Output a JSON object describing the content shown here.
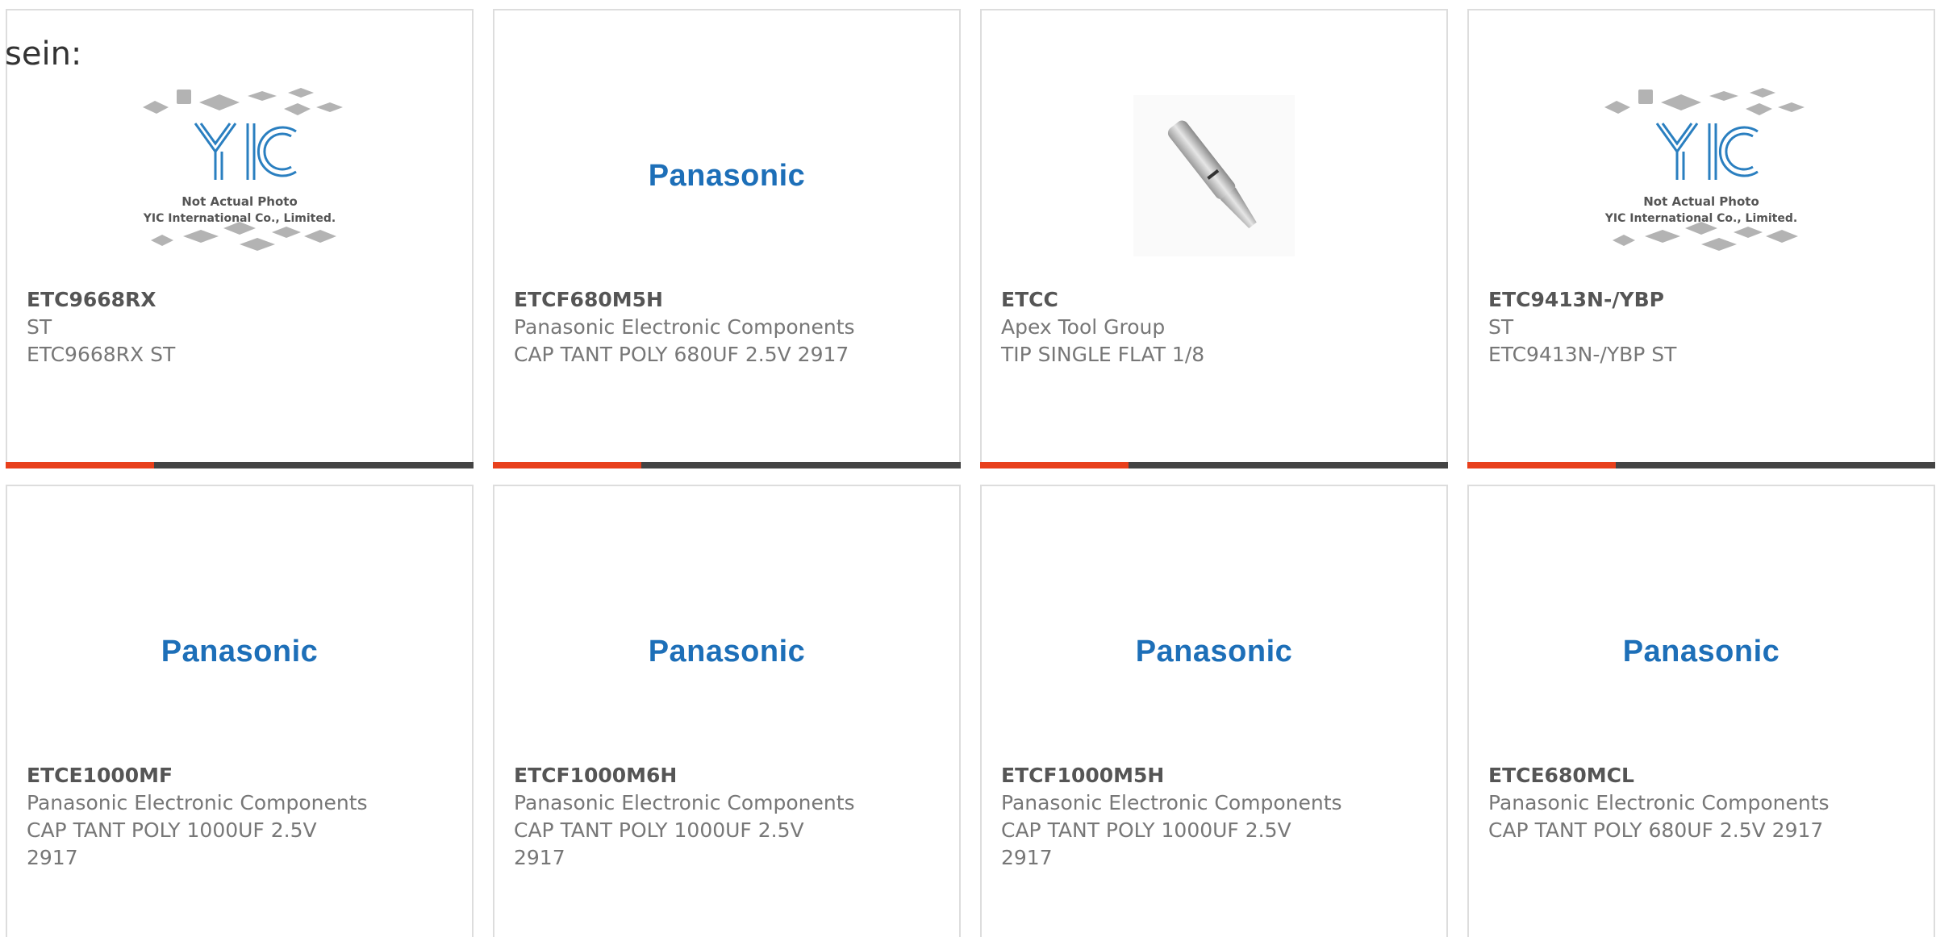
{
  "page": {
    "lead_text": "sein:"
  },
  "colors": {
    "accent": "#e8401c",
    "bar": "#444444",
    "panasonic_blue": "#1d6fb8",
    "yic_blue": "#2a7fc0"
  },
  "cards": [
    {
      "part": "ETC9668RX",
      "mfr": "ST",
      "desc": "ETC9668RX ST",
      "image": "yic-not-actual-photo",
      "image_text": {
        "line1": "Not Actual Photo",
        "line2": "YIC International Co., Limited.",
        "logo": "YIC"
      }
    },
    {
      "part": "ETCF680M5H",
      "mfr": "Panasonic Electronic Components",
      "desc": "CAP TANT POLY 680UF 2.5V 2917",
      "image": "panasonic-logo",
      "logo_text": "Panasonic"
    },
    {
      "part": "ETCC",
      "mfr": "Apex Tool Group",
      "desc": "TIP SINGLE FLAT 1/8",
      "image": "solder-tip-photo"
    },
    {
      "part": "ETC9413N-/YBP",
      "mfr": "ST",
      "desc": "ETC9413N-/YBP ST",
      "image": "yic-not-actual-photo",
      "image_text": {
        "line1": "Not Actual Photo",
        "line2": "YIC International Co., Limited.",
        "logo": "YIC"
      }
    },
    {
      "part": "ETCE1000MF",
      "mfr": "Panasonic Electronic Components",
      "desc1": "CAP TANT POLY 1000UF 2.5V",
      "desc2": "2917",
      "image": "panasonic-logo",
      "logo_text": "Panasonic"
    },
    {
      "part": "ETCF1000M6H",
      "mfr": "Panasonic Electronic Components",
      "desc1": "CAP TANT POLY 1000UF 2.5V",
      "desc2": "2917",
      "image": "panasonic-logo",
      "logo_text": "Panasonic"
    },
    {
      "part": "ETCF1000M5H",
      "mfr": "Panasonic Electronic Components",
      "desc1": "CAP TANT POLY 1000UF 2.5V",
      "desc2": "2917",
      "image": "panasonic-logo",
      "logo_text": "Panasonic"
    },
    {
      "part": "ETCE680MCL",
      "mfr": "Panasonic Electronic Components",
      "desc": "CAP TANT POLY 680UF 2.5V 2917",
      "image": "panasonic-logo",
      "logo_text": "Panasonic"
    }
  ]
}
